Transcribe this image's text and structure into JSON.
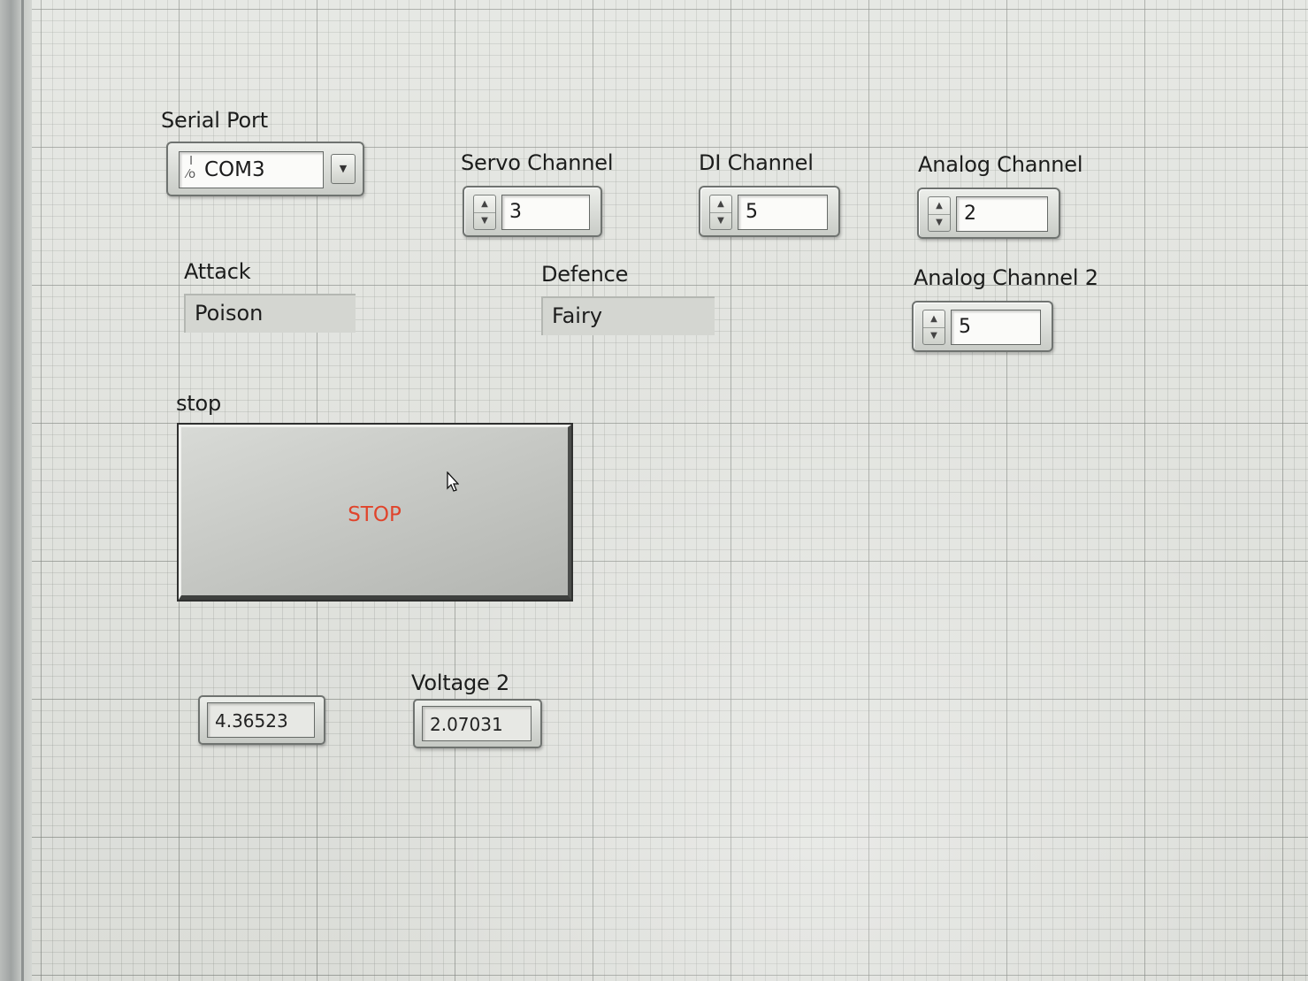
{
  "serial_port": {
    "label": "Serial Port",
    "value": "COM3",
    "icon": "visa-resource-icon"
  },
  "servo_channel": {
    "label": "Servo Channel",
    "value": "3"
  },
  "di_channel": {
    "label": "DI Channel",
    "value": "5"
  },
  "analog_channel": {
    "label": "Analog Channel",
    "value": "2"
  },
  "analog_channel_2": {
    "label": "Analog Channel 2",
    "value": "5"
  },
  "attack": {
    "label": "Attack",
    "value": "Poison"
  },
  "defence": {
    "label": "Defence",
    "value": "Fairy"
  },
  "stop": {
    "label": "stop",
    "button_text": "STOP",
    "text_color": "#e0442b"
  },
  "voltage_1": {
    "value": "4.36523"
  },
  "voltage_2": {
    "label": "Voltage 2",
    "value": "2.07031"
  }
}
